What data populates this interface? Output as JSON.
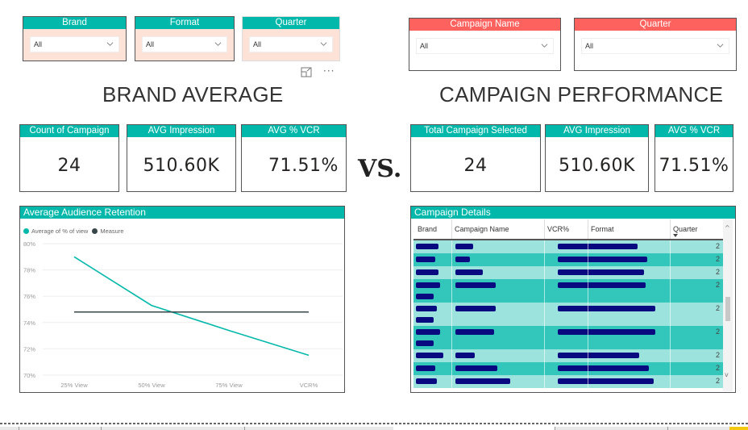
{
  "left_slicers": [
    {
      "title": "Brand",
      "value": "All"
    },
    {
      "title": "Format",
      "value": "All"
    },
    {
      "title": "Quarter",
      "value": "All"
    }
  ],
  "right_slicers": [
    {
      "title": "Campaign Name",
      "value": "All"
    },
    {
      "title": "Quarter",
      "value": "All"
    }
  ],
  "visual_header": {
    "focus_icon": "focus-mode-icon",
    "more_icon": "more-options-icon",
    "more_glyph": "···"
  },
  "sections": {
    "left_title": "BRAND AVERAGE",
    "right_title": "CAMPAIGN PERFORMANCE",
    "vs_label": "VS."
  },
  "left_cards": [
    {
      "title": "Count of Campaign",
      "value": "24"
    },
    {
      "title": "AVG Impression",
      "value": "510.60K"
    },
    {
      "title": "AVG % VCR",
      "value": "71.51%"
    }
  ],
  "right_cards": [
    {
      "title": "Total Campaign Selected",
      "value": "24"
    },
    {
      "title": "AVG Impression",
      "value": "510.60K"
    },
    {
      "title": "AVG % VCR",
      "value": "71.51%"
    }
  ],
  "colors": {
    "teal": "#01b8aa",
    "slicer_red": "#fd625e",
    "slicer_bg": "#fde3d7",
    "measure_line": "#374649",
    "row_light": "#9be3dc",
    "row_dark": "#33c6bb",
    "redaction": "#0a0a80"
  },
  "chart_data": {
    "type": "line",
    "title": "Average Audience Retention",
    "categories": [
      "25% View",
      "50% View",
      "75% View",
      "VCR%"
    ],
    "series": [
      {
        "name": "Average of % of view",
        "values": [
          79.0,
          75.3,
          73.4,
          71.51
        ],
        "color": "#01b8aa"
      },
      {
        "name": "Measure",
        "values": [
          74.8,
          74.8,
          74.8,
          74.8
        ],
        "color": "#374649"
      }
    ],
    "yticks": [
      "70%",
      "72%",
      "74%",
      "76%",
      "78%",
      "80%"
    ],
    "ylim": [
      70,
      80
    ],
    "xlabel": "",
    "ylabel": "",
    "grid": true,
    "legend": "top-left"
  },
  "table": {
    "title": "Campaign Details",
    "columns": [
      "Brand",
      "Campaign Name",
      "VCR%",
      "Format",
      "Quarter"
    ],
    "sort_column": "Quarter",
    "rows": [
      {
        "quarter": "2",
        "shade": "light",
        "tall": false
      },
      {
        "quarter": "2",
        "shade": "dark",
        "tall": false
      },
      {
        "quarter": "2",
        "shade": "light",
        "tall": false
      },
      {
        "quarter": "2",
        "shade": "dark",
        "tall": true
      },
      {
        "quarter": "2",
        "shade": "light",
        "tall": true
      },
      {
        "quarter": "2",
        "shade": "dark",
        "tall": true
      },
      {
        "quarter": "2",
        "shade": "light",
        "tall": false
      },
      {
        "quarter": "2",
        "shade": "dark",
        "tall": false
      },
      {
        "quarter": "2",
        "shade": "light",
        "tall": false
      }
    ],
    "redacted_note": "Brand, Campaign Name, VCR% and Format cell values are redacted"
  }
}
